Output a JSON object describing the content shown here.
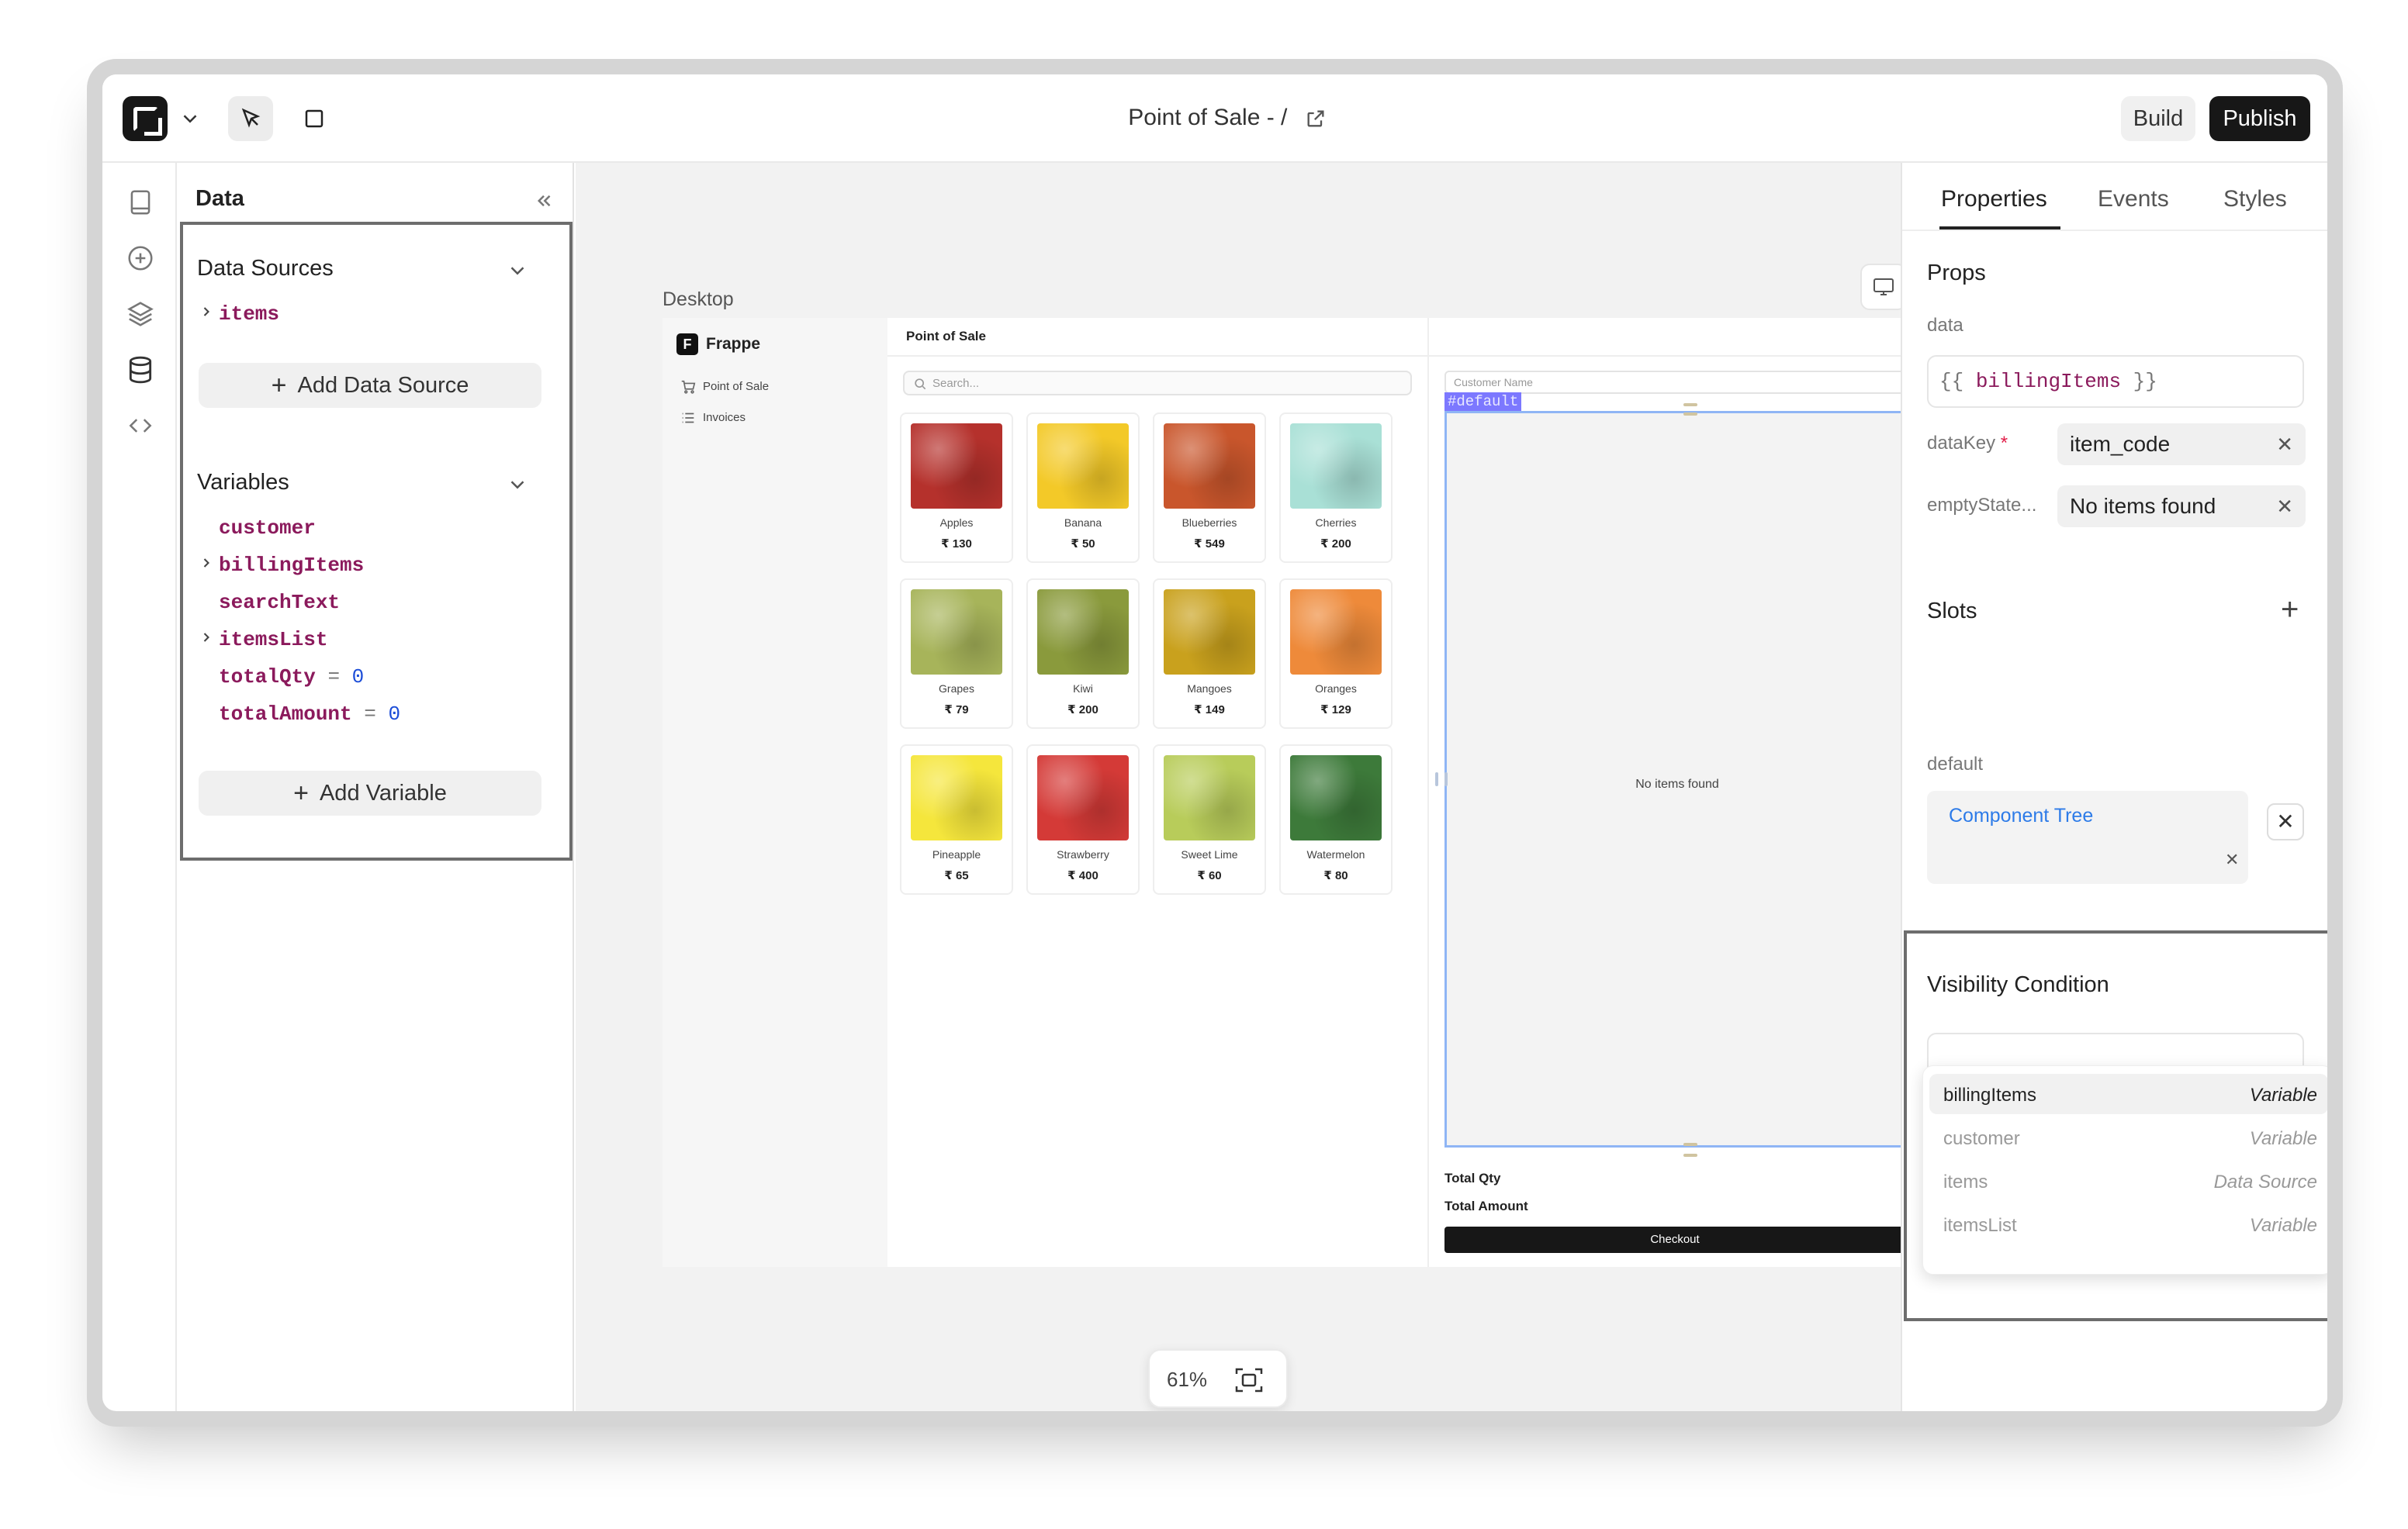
{
  "topbar": {
    "title": "Point of Sale - /",
    "build_label": "Build",
    "publish_label": "Publish"
  },
  "data_panel": {
    "header": "Data",
    "data_sources": {
      "title": "Data Sources",
      "items": [
        {
          "name": "items",
          "expandable": true
        }
      ],
      "add_label": "Add Data Source"
    },
    "variables": {
      "title": "Variables",
      "items": [
        {
          "name": "customer",
          "expandable": false,
          "value": ""
        },
        {
          "name": "billingItems",
          "expandable": true,
          "value": ""
        },
        {
          "name": "searchText",
          "expandable": false,
          "value": ""
        },
        {
          "name": "itemsList",
          "expandable": true,
          "value": ""
        },
        {
          "name": "totalQty",
          "expandable": false,
          "op": "=",
          "value": "0"
        },
        {
          "name": "totalAmount",
          "expandable": false,
          "op": "=",
          "value": "0"
        }
      ],
      "add_label": "Add Variable"
    }
  },
  "canvas": {
    "breakpoint_label": "Desktop",
    "zoom": "61%",
    "app": {
      "brand": "Frappe",
      "brand_letter": "F",
      "nav": [
        "Point of Sale",
        "Invoices"
      ],
      "page_title": "Point of Sale",
      "search_placeholder": "Search...",
      "products": [
        {
          "name": "Apples",
          "price": "₹ 130",
          "color": "#b5312c"
        },
        {
          "name": "Banana",
          "price": "₹ 50",
          "color": "#f3c928"
        },
        {
          "name": "Blueberries",
          "price": "₹ 549",
          "color": "#c9562c"
        },
        {
          "name": "Cherries",
          "price": "₹ 200",
          "color": "#a9e0d6"
        },
        {
          "name": "Grapes",
          "price": "₹ 79",
          "color": "#a7b45a"
        },
        {
          "name": "Kiwi",
          "price": "₹ 200",
          "color": "#8a9a3c"
        },
        {
          "name": "Mangoes",
          "price": "₹ 149",
          "color": "#c9a11d"
        },
        {
          "name": "Oranges",
          "price": "₹ 129",
          "color": "#ee8a3a"
        },
        {
          "name": "Pineapple",
          "price": "₹ 65",
          "color": "#f5e63c"
        },
        {
          "name": "Strawberry",
          "price": "₹ 400",
          "color": "#d43a37"
        },
        {
          "name": "Sweet Lime",
          "price": "₹ 60",
          "color": "#b8cc5a"
        },
        {
          "name": "Watermelon",
          "price": "₹ 80",
          "color": "#3d7a3a"
        }
      ],
      "customer_placeholder": "Customer Name",
      "slot_tag": "#default",
      "empty_text": "No items found",
      "total_qty_label": "Total Qty",
      "total_amount_label": "Total Amount",
      "checkout_label": "Checkout"
    }
  },
  "properties": {
    "tabs": [
      "Properties",
      "Events",
      "Styles"
    ],
    "props_title": "Props",
    "data_label": "data",
    "data_value": {
      "open": "{{",
      "var": "billingItems",
      "close": "}}"
    },
    "datakey_label": "dataKey",
    "datakey_required": "*",
    "datakey_value": "item_code",
    "emptystate_label": "emptyState...",
    "emptystate_value": "No items found",
    "slots_title": "Slots",
    "slot_default_label": "default",
    "slot_default_value": "Component Tree",
    "visibility_title": "Visibility Condition",
    "suggestions": [
      {
        "name": "billingItems",
        "type": "Variable",
        "highlighted": true
      },
      {
        "name": "customer",
        "type": "Variable",
        "highlighted": false
      },
      {
        "name": "items",
        "type": "Data Source",
        "highlighted": false
      },
      {
        "name": "itemsList",
        "type": "Variable",
        "highlighted": false
      }
    ]
  }
}
